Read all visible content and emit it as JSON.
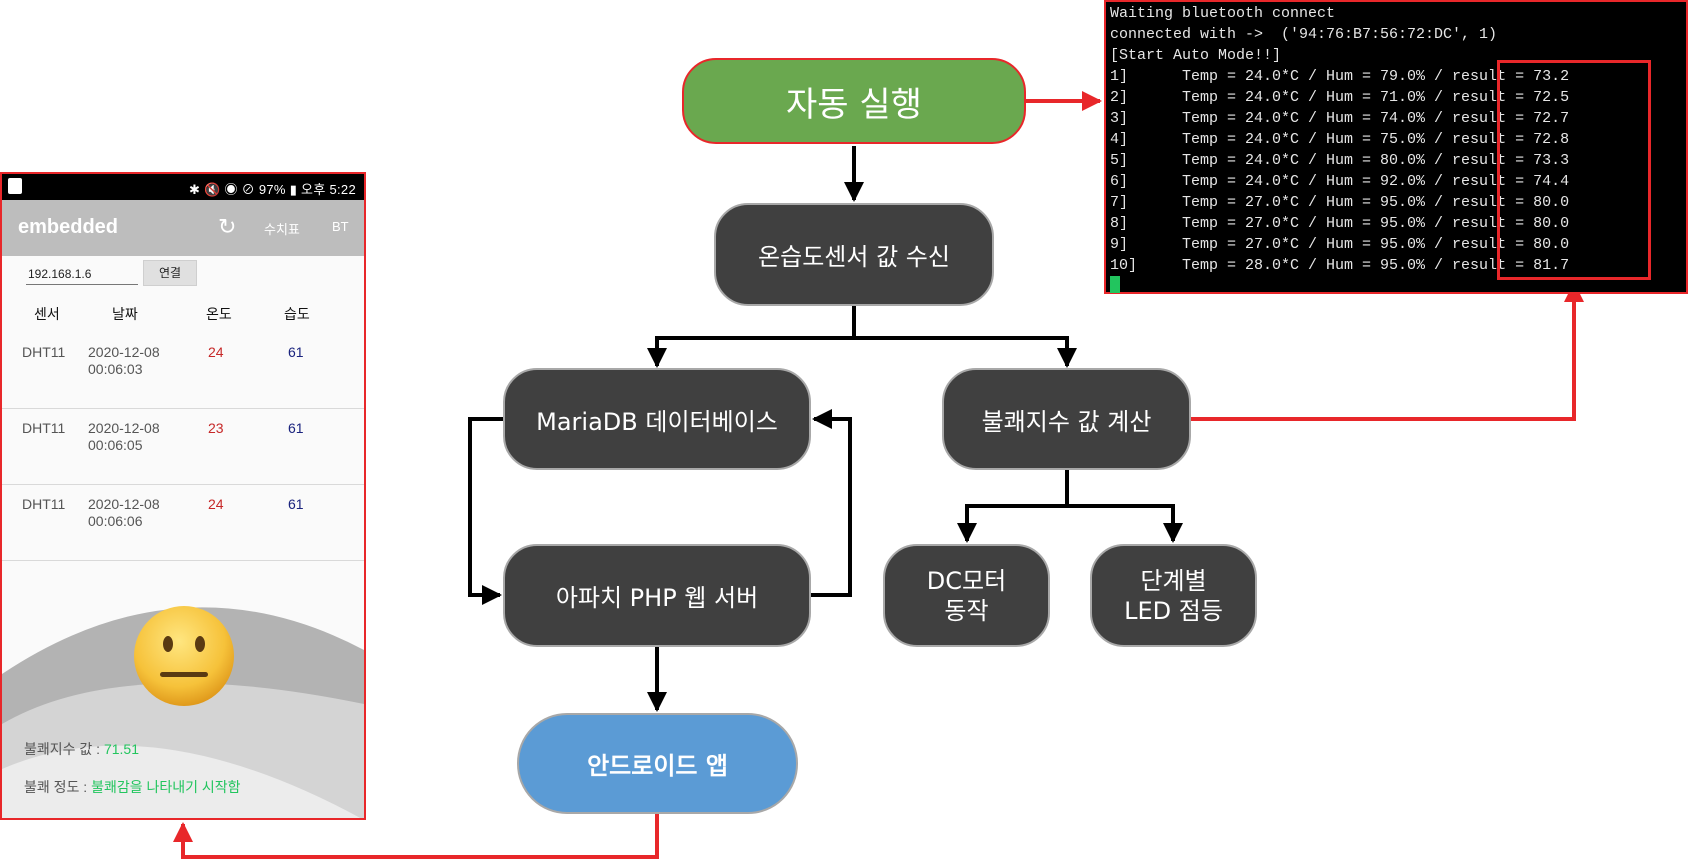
{
  "phone": {
    "status_time": "✱ 🔇 ◉ ⊘ 97% ▮ 오후 5:22",
    "app_title": "embedded",
    "refresh_icon": "↻",
    "table_button": "수치표",
    "bt_button": "BT",
    "ip_value": "192.168.1.6",
    "connect_button": "연결",
    "headers": [
      "센서",
      "날짜",
      "온도",
      "습도"
    ],
    "rows": [
      {
        "sensor": "DHT11",
        "date": "2020-12-08",
        "time": "00:06:03",
        "temp": "24",
        "hum": "61"
      },
      {
        "sensor": "DHT11",
        "date": "2020-12-08",
        "time": "00:06:05",
        "temp": "23",
        "hum": "61"
      },
      {
        "sensor": "DHT11",
        "date": "2020-12-08",
        "time": "00:06:06",
        "temp": "24",
        "hum": "61"
      }
    ],
    "emoji_icon": "neutral-face",
    "index_label": "불쾌지수 값 : ",
    "index_value": "71.51",
    "level_label": "불쾌 정도 : ",
    "level_value": "불쾌감을 나타내기 시작함"
  },
  "terminal": {
    "lines": [
      "Waiting bluetooth connect",
      "connected with ->  ('94:76:B7:56:72:DC', 1)",
      "[Start Auto Mode!!]",
      "1]      Temp = 24.0*C / Hum = 79.0% / result = 73.2",
      "2]      Temp = 24.0*C / Hum = 71.0% / result = 72.5",
      "3]      Temp = 24.0*C / Hum = 74.0% / result = 72.7",
      "4]      Temp = 24.0*C / Hum = 75.0% / result = 72.8",
      "5]      Temp = 24.0*C / Hum = 80.0% / result = 73.3",
      "6]      Temp = 24.0*C / Hum = 92.0% / result = 74.4",
      "7]      Temp = 27.0*C / Hum = 95.0% / result = 80.0",
      "8]      Temp = 27.0*C / Hum = 95.0% / result = 80.0",
      "9]      Temp = 27.0*C / Hum = 95.0% / result = 80.0",
      "10]     Temp = 28.0*C / Hum = 95.0% / result = 81.7"
    ]
  },
  "nodes": {
    "auto": "자동 실행",
    "sensor": "온습도센서 값 수신",
    "mariadb": "MariaDB 데이터베이스",
    "discomfort": "불쾌지수 값 계산",
    "apache": "아파치 PHP 웹 서버",
    "dcmotor_1": "DC모터",
    "dcmotor_2": "동작",
    "led_1": "단계별",
    "led_2": "LED 점등",
    "android": "안드로이드 앱"
  },
  "colors": {
    "accent_red": "#e8272a",
    "node_dark": "#404040",
    "node_green": "#6aa84f",
    "node_blue": "#5b9bd5",
    "terminal_green": "#22c55e"
  }
}
